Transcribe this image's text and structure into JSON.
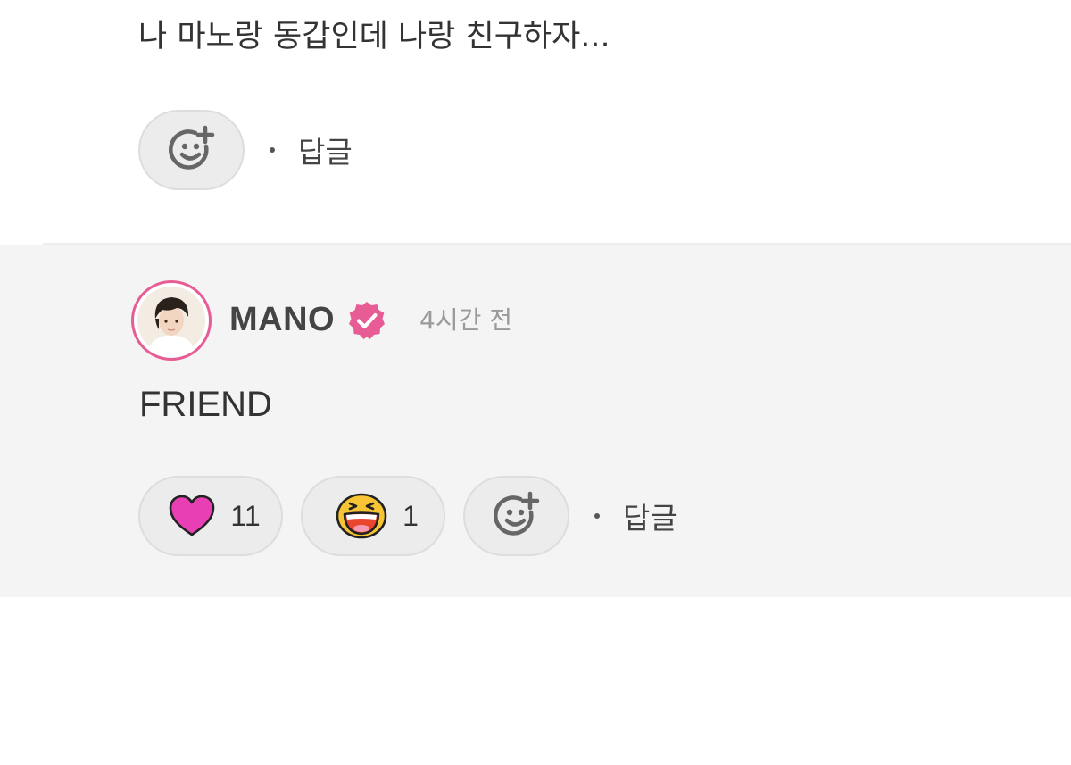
{
  "comment": {
    "text": "나 마노랑 동갑인데 나랑 친구하자...",
    "reply_label": "답글"
  },
  "reply": {
    "author": "MANO",
    "verified": true,
    "timestamp": "4시간 전",
    "text": "FRIEND",
    "reactions": [
      {
        "icon": "heart-icon",
        "count": "11"
      },
      {
        "icon": "laughing-face-icon",
        "count": "1"
      }
    ],
    "reply_label": "답글"
  },
  "colors": {
    "accent": "#e85c95",
    "heart": "#e93fb5",
    "reply_background": "#f4f4f4",
    "pill_background": "#ececec"
  }
}
